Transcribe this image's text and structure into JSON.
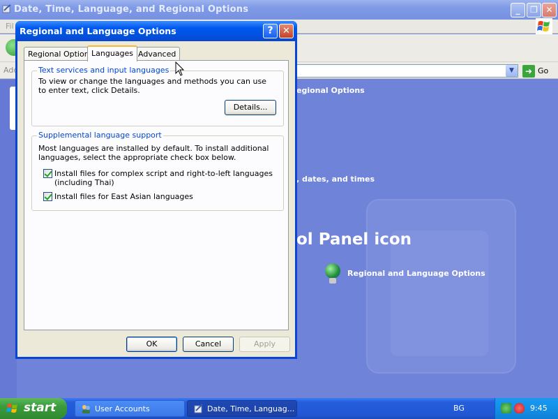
{
  "background_window": {
    "title": "Date, Time, Language, and Regional Options",
    "menu_partial": "Fil",
    "address_label_partial": "Add",
    "go_label": "Go",
    "heading_partial_1": "egional Options",
    "heading_partial_2": ", dates, and times",
    "big_heading_partial": "ol Panel icon",
    "control_panel_link": "Regional and Language Options"
  },
  "dialog": {
    "title": "Regional and Language Options",
    "help_glyph": "?",
    "close_glyph": "✕",
    "tabs": [
      {
        "label": "Regional Options",
        "active": false
      },
      {
        "label": "Languages",
        "active": true
      },
      {
        "label": "Advanced",
        "active": false
      }
    ],
    "text_services": {
      "legend": "Text services and input languages",
      "description": "To view or change the languages and methods you can use to enter text, click Details.",
      "details_button": "Details..."
    },
    "supplemental": {
      "legend": "Supplemental language support",
      "description": "Most languages are installed by default. To install additional languages, select the appropriate check box below.",
      "checkboxes": [
        {
          "label": "Install files for complex script and right-to-left languages (including Thai)",
          "checked": true
        },
        {
          "label": "Install files for East Asian languages",
          "checked": true
        }
      ]
    },
    "buttons": {
      "ok": "OK",
      "cancel": "Cancel",
      "apply": "Apply"
    }
  },
  "taskbar": {
    "start_label": "start",
    "items": [
      {
        "label": "User Accounts",
        "active": false
      },
      {
        "label": "Date, Time, Languag...",
        "active": true
      }
    ],
    "language": "BG",
    "clock": "9:45"
  },
  "colors": {
    "desktop_blue": "#6f83d9",
    "titlebar_blue": "#0058ee",
    "dialog_face": "#ece9d8",
    "legend_blue": "#0046d5",
    "start_green": "#3b9b3b"
  }
}
